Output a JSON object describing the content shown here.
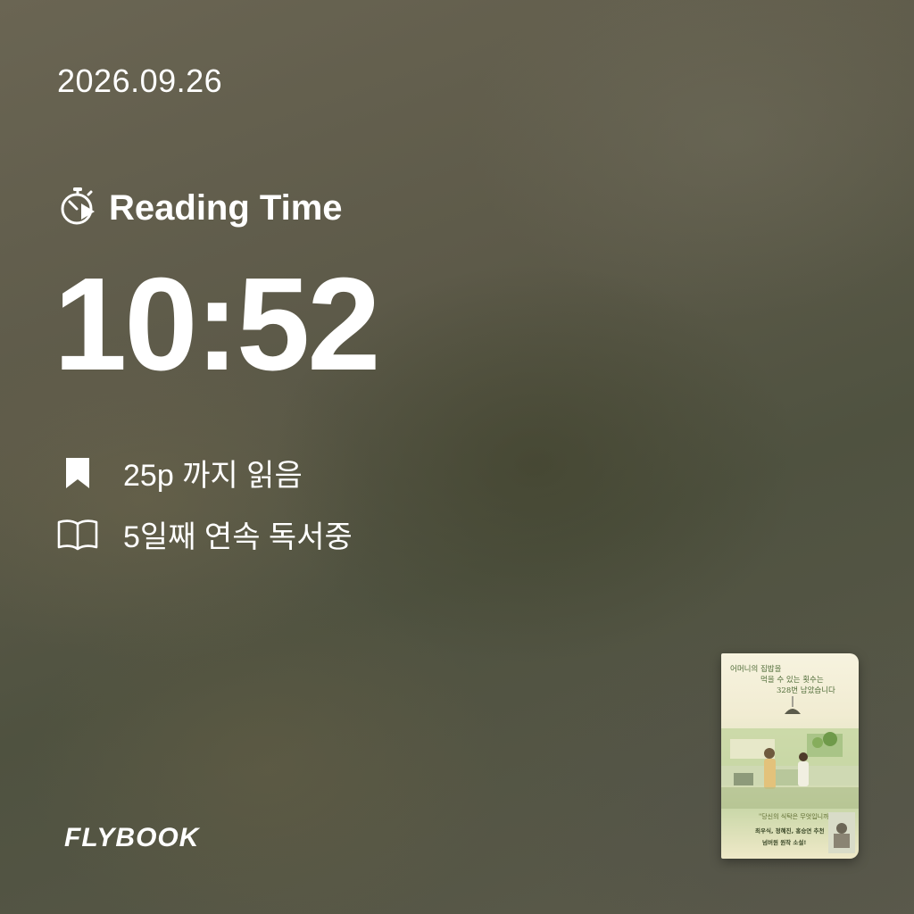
{
  "date": "2026.09.26",
  "reading": {
    "label": "Reading Time",
    "time": "10:52"
  },
  "stats": {
    "pages_read": "25p 까지 읽음",
    "streak": "5일째 연속 독서중"
  },
  "brand": {
    "logo": "FLYBOOK"
  },
  "icons": {
    "timer": "timer-play-icon",
    "bookmark": "bookmark-icon",
    "open_book": "open-book-icon"
  },
  "colors": {
    "text": "#ffffff"
  },
  "book": {
    "cover_line1": "어머니의 집밥을",
    "cover_line2": "먹을 수 있는 횟수는",
    "cover_line3": "328번 남았습니다",
    "tagline": "\"당신의 식탁은 무엇입니까?\"",
    "recommend": "최우식, 정혜진, 홍승연 추천",
    "series": "넘버원 원작 소설!"
  }
}
